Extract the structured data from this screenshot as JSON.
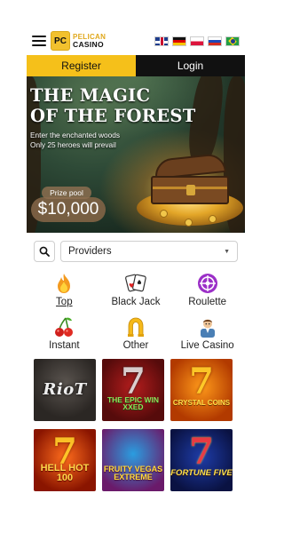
{
  "header": {
    "logo_pc": "PC",
    "logo_line1": "PELICAN",
    "logo_line2": "CASINO",
    "flags": [
      "english-flag-icon",
      "german-flag-icon",
      "polish-flag-icon",
      "russian-flag-icon",
      "brazilian-flag-icon"
    ]
  },
  "auth": {
    "register_label": "Register",
    "login_label": "Login"
  },
  "banner": {
    "title_line1": "THE MAGIC",
    "title_line2": "OF THE FOREST",
    "subtitle_line1": "Enter the enchanted woods",
    "subtitle_line2": "Only 25 heroes will prevail",
    "prize_label": "Prize pool",
    "prize_amount": "$10,000"
  },
  "search": {
    "provider_select_value": "Providers"
  },
  "categories": [
    {
      "label": "Top",
      "icon": "fire-icon"
    },
    {
      "label": "Black Jack",
      "icon": "cards-icon"
    },
    {
      "label": "Roulette",
      "icon": "roulette-icon"
    },
    {
      "label": "Instant",
      "icon": "cherries-icon"
    },
    {
      "label": "Other",
      "icon": "horseshoe-icon"
    },
    {
      "label": "Live Casino",
      "icon": "dealer-icon"
    }
  ],
  "games": [
    {
      "title": "RioT"
    },
    {
      "title": "THE EPIC WIN XXED"
    },
    {
      "title": "CRYSTAL COINS"
    },
    {
      "title": "HELL HOT 100"
    },
    {
      "title": "FRUITY VEGAS EXTREME"
    },
    {
      "title": "FORTUNE FIVE"
    }
  ],
  "colors": {
    "accent": "#f5c01a",
    "dark": "#111111",
    "roulette_purple": "#9b2fc7"
  }
}
